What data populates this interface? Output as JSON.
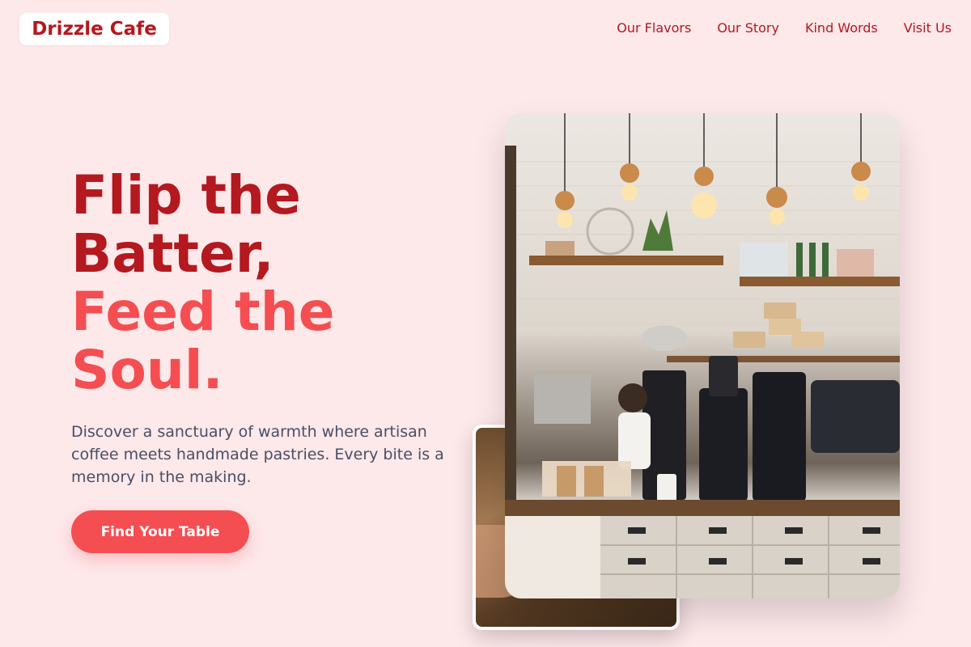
{
  "brand": {
    "name": "Drizzle Cafe"
  },
  "nav": {
    "items": [
      "Our Flavors",
      "Our Story",
      "Kind Words",
      "Visit Us"
    ]
  },
  "hero": {
    "headline_line1": "Flip the",
    "headline_line2": "Batter,",
    "headline_line3": "Feed the",
    "headline_line4": "Soul.",
    "description": "Discover a sanctuary of warmth where artisan coffee meets handmade pastries. Every bite is a memory in the making.",
    "cta_label": "Find Your Table"
  },
  "colors": {
    "background": "#fde8ea",
    "primary": "#b3191f",
    "accent": "#f44e52",
    "text": "#4a4f63"
  }
}
